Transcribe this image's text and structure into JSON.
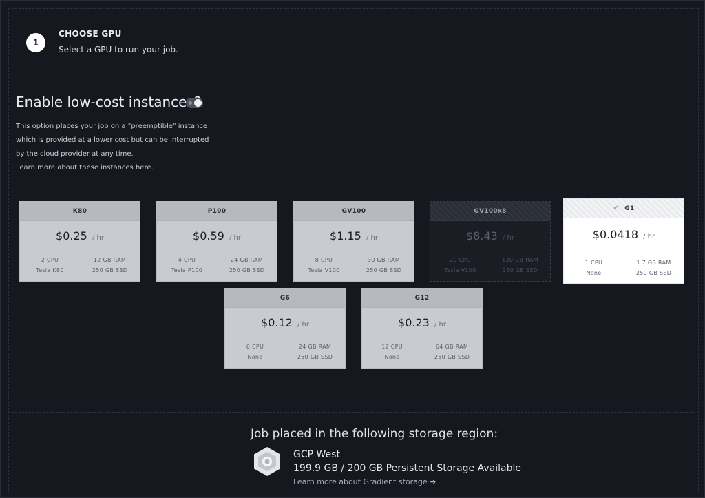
{
  "step": {
    "number": "1",
    "title": "CHOOSE GPU",
    "subtitle": "Select a GPU to run your job."
  },
  "low_cost": {
    "title": "Enable low-cost instances?",
    "toggle_on": true,
    "desc_lines": [
      "This option places your job on a \"preemptible\" instance",
      "which is provided at a lower cost but can be interrupted",
      "by the cloud provider at any time."
    ],
    "learn_more_prefix": "Learn more about these instances ",
    "learn_more_link": "here",
    "learn_more_suffix": "."
  },
  "gpus": [
    {
      "name": "K80",
      "price": "$0.25",
      "unit": "/ hr",
      "cpu": "2 CPU",
      "ram": "12 GB RAM",
      "gpu": "Tesla K80",
      "ssd": "250 GB SSD"
    },
    {
      "name": "P100",
      "price": "$0.59",
      "unit": "/ hr",
      "cpu": "4 CPU",
      "ram": "24 GB RAM",
      "gpu": "Tesla P100",
      "ssd": "250 GB SSD"
    },
    {
      "name": "GV100",
      "price": "$1.15",
      "unit": "/ hr",
      "cpu": "8 CPU",
      "ram": "30 GB RAM",
      "gpu": "Tesla V100",
      "ssd": "250 GB SSD"
    },
    {
      "name": "GV100x8",
      "price": "$8.43",
      "unit": "/ hr",
      "cpu": "20 CPU",
      "ram": "130 GB RAM",
      "gpu": "Tesla V100",
      "ssd": "250 GB SSD",
      "state": "disabled"
    },
    {
      "name": "G1",
      "price": "$0.0418",
      "unit": "/ hr",
      "cpu": "1 CPU",
      "ram": "1.7 GB RAM",
      "gpu": "None",
      "ssd": "250 GB SSD",
      "state": "selected"
    },
    {
      "name": "G6",
      "price": "$0.12",
      "unit": "/ hr",
      "cpu": "6 CPU",
      "ram": "24 GB RAM",
      "gpu": "None",
      "ssd": "250 GB SSD"
    },
    {
      "name": "G12",
      "price": "$0.23",
      "unit": "/ hr",
      "cpu": "12 CPU",
      "ram": "64 GB RAM",
      "gpu": "None",
      "ssd": "250 GB SSD"
    }
  ],
  "storage": {
    "title": "Job placed in the following storage region:",
    "region": "GCP West",
    "available": "199.9 GB / 200 GB Persistent Storage Available",
    "learn_more": "Learn more about Gradient storage",
    "icon": "gcp-hexagon-icon"
  },
  "colors": {
    "background": "#161820",
    "card": "#c9cbd0",
    "card_selected": "#ffffff",
    "card_disabled": "#1a1d24"
  }
}
